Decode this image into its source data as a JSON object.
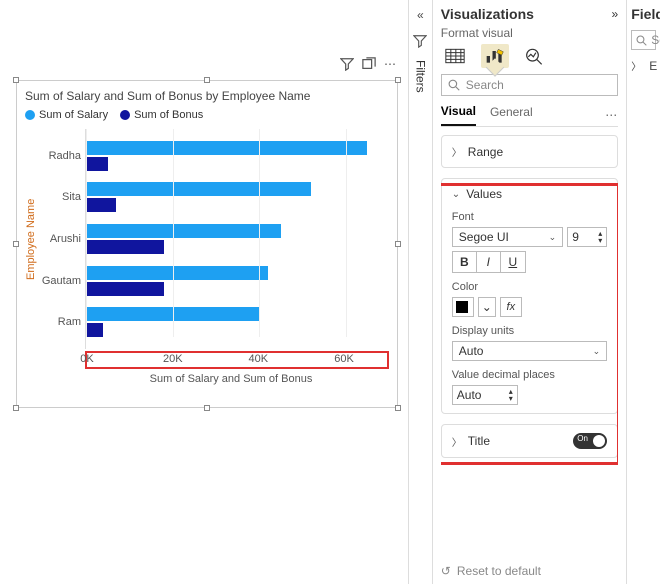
{
  "chart_data": {
    "type": "bar",
    "orientation": "horizontal",
    "title": "Sum of Salary and Sum of Bonus by Employee Name",
    "ylabel": "Employee Name",
    "xlabel": "Sum of Salary and Sum of Bonus",
    "x_ticks": [
      "0K",
      "20K",
      "40K",
      "60K"
    ],
    "xlim": [
      0,
      70000
    ],
    "categories": [
      "Radha",
      "Sita",
      "Arushi",
      "Gautam",
      "Ram"
    ],
    "series": [
      {
        "name": "Sum of Salary",
        "color": "#1ea0f2",
        "values": [
          65000,
          52000,
          45000,
          42000,
          40000
        ]
      },
      {
        "name": "Sum of Bonus",
        "color": "#10159e",
        "values": [
          5000,
          7000,
          18000,
          18000,
          4000
        ]
      }
    ]
  },
  "visual_toolbar": {
    "filter": "filter-icon",
    "focus": "focus-mode-icon",
    "more": "⋯"
  },
  "rail": {
    "filters_label": "Filters"
  },
  "viz_pane": {
    "title": "Visualizations",
    "subtitle": "Format visual",
    "search_placeholder": "Search",
    "tabs": {
      "visual": "Visual",
      "general": "General"
    },
    "cards": {
      "range": "Range",
      "values": {
        "title": "Values",
        "font_label": "Font",
        "font_family": "Segoe UI",
        "font_size": "9",
        "bold": "B",
        "italic": "I",
        "underline": "U",
        "color_label": "Color",
        "fx": "fx",
        "display_units_label": "Display units",
        "display_units_value": "Auto",
        "decimal_label": "Value decimal places",
        "decimal_value": "Auto"
      },
      "title_card": "Title",
      "toggle_on": "On"
    },
    "reset": "Reset to default"
  },
  "fields_pane": {
    "title": "Fields",
    "search_ph_short": "Se",
    "table_short": "E"
  }
}
